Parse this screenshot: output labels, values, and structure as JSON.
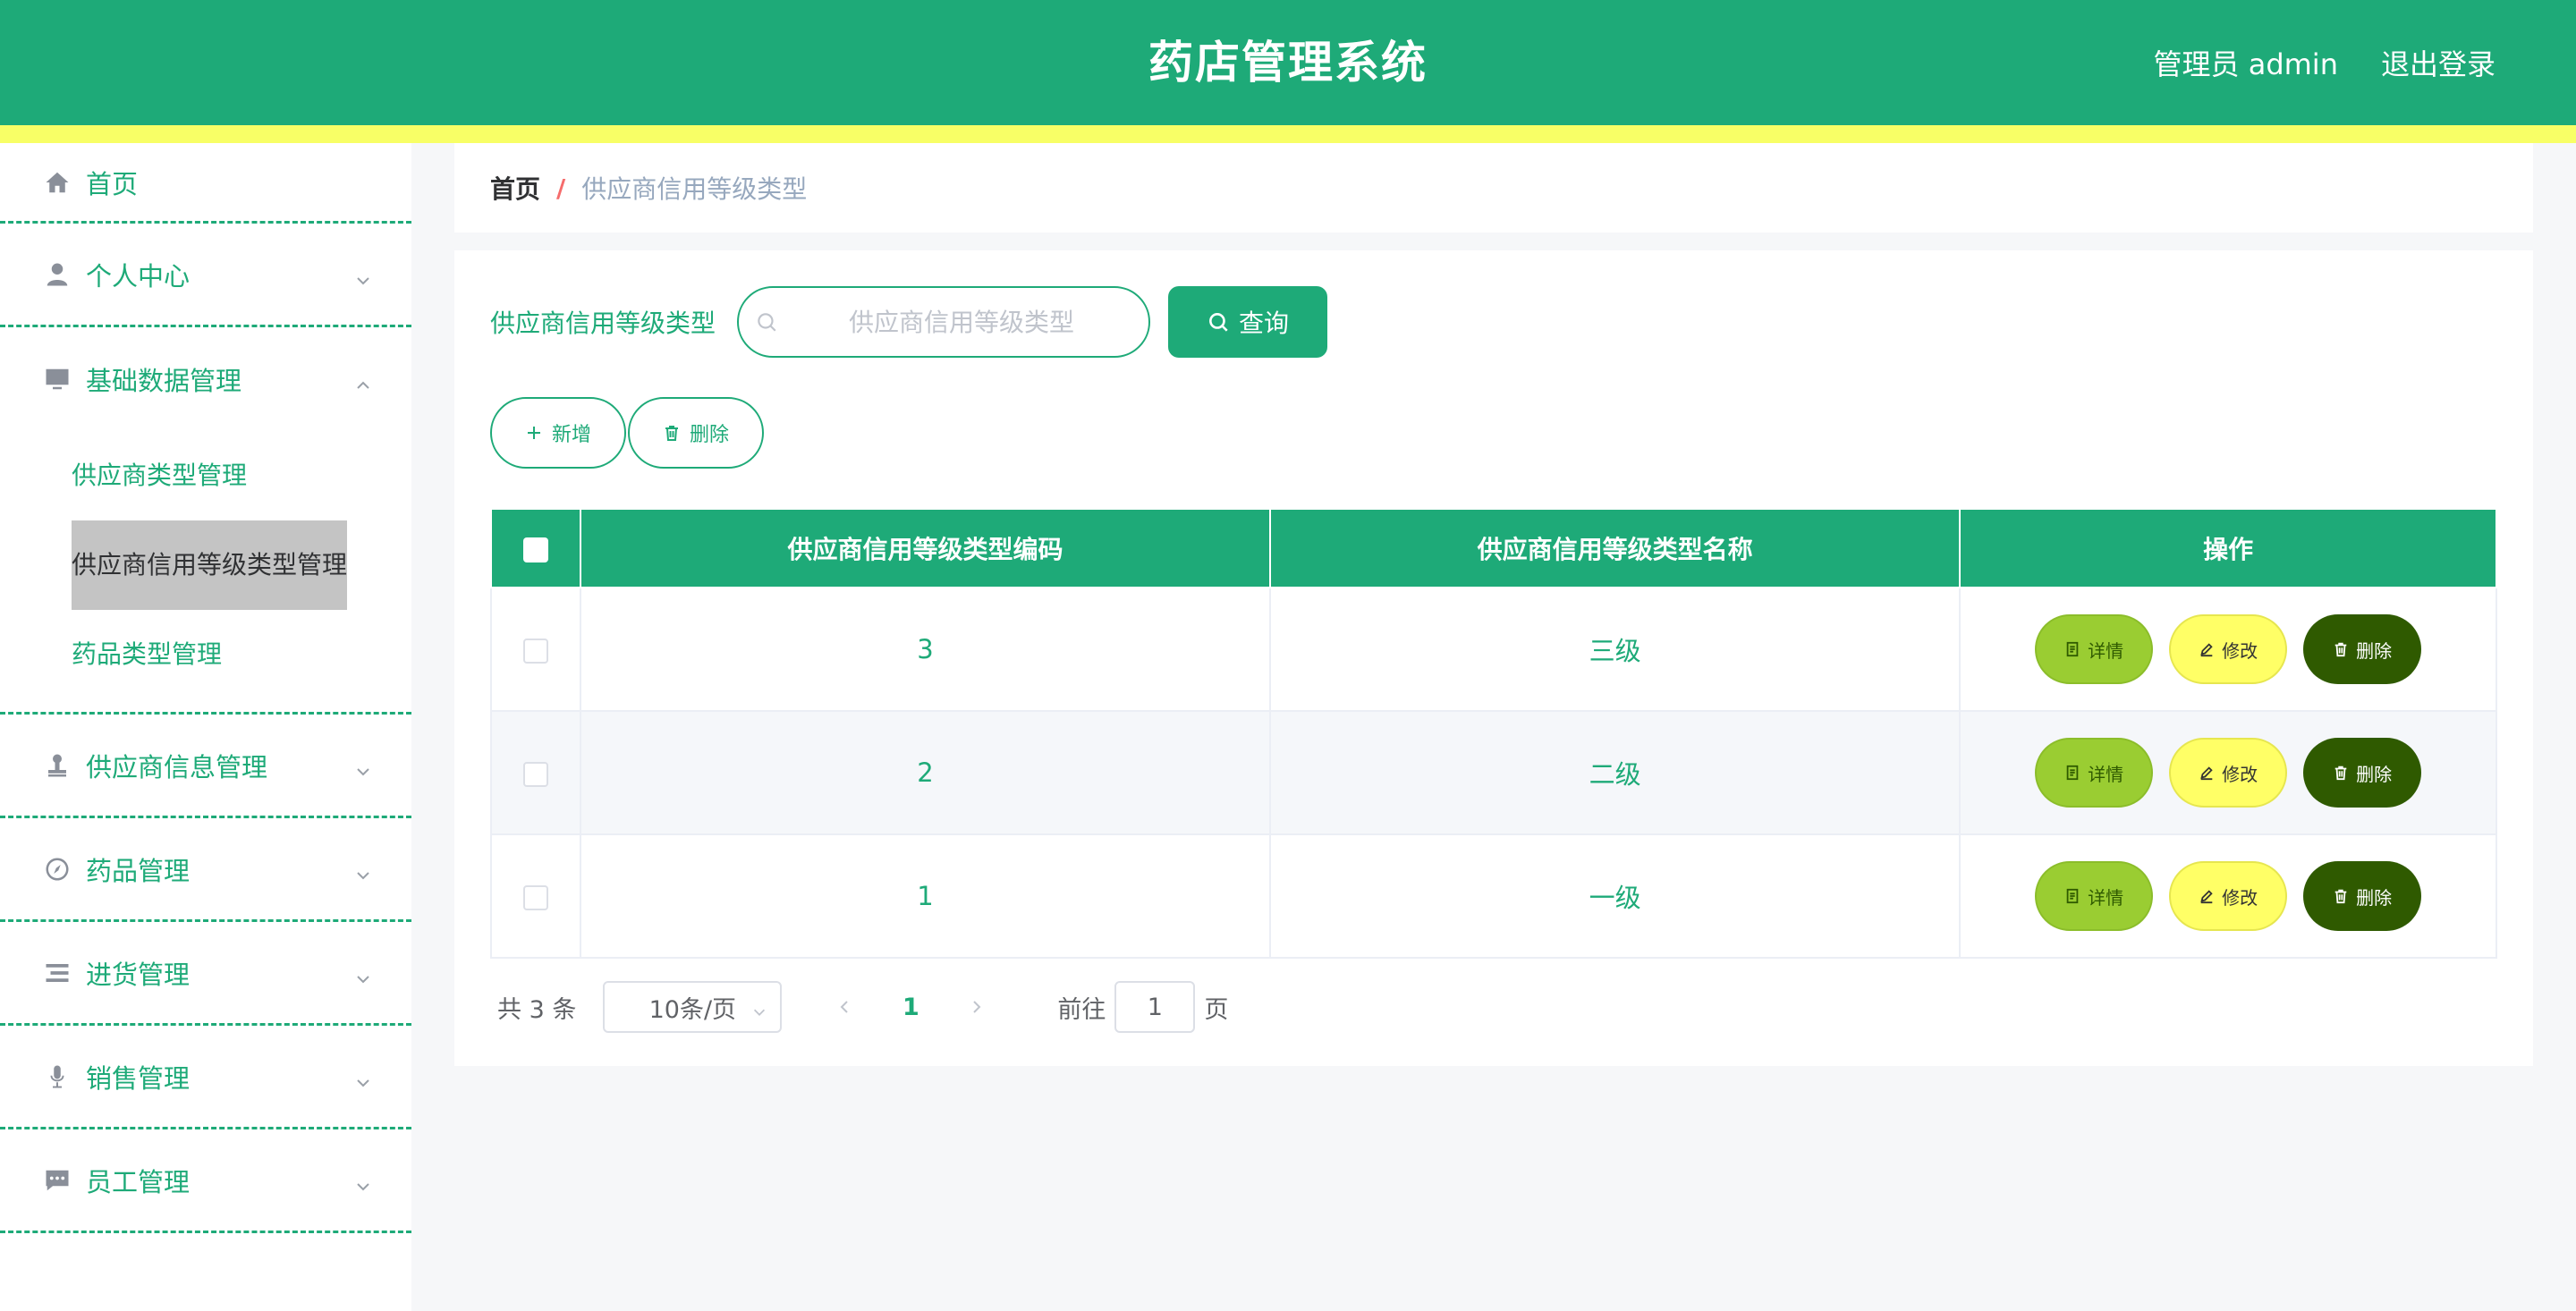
{
  "header": {
    "title": "药店管理系统",
    "user_label": "管理员 admin",
    "logout_label": "退出登录",
    "colors": {
      "primary": "#1eaa78",
      "stripe": "#f8ff66"
    }
  },
  "sidebar": {
    "items": [
      {
        "label": "首页",
        "icon": "home-icon"
      },
      {
        "label": "个人中心",
        "icon": "user-icon"
      },
      {
        "label": "基础数据管理",
        "icon": "monitor-icon",
        "expanded": true,
        "children": [
          {
            "label": "供应商类型管理"
          },
          {
            "label": "供应商信用等级类型管理",
            "active": true
          },
          {
            "label": "药品类型管理"
          }
        ]
      },
      {
        "label": "供应商信息管理",
        "icon": "stamp-icon"
      },
      {
        "label": "药品管理",
        "icon": "compass-icon"
      },
      {
        "label": "进货管理",
        "icon": "list-icon"
      },
      {
        "label": "销售管理",
        "icon": "microphone-icon"
      },
      {
        "label": "员工管理",
        "icon": "chat-icon"
      }
    ]
  },
  "breadcrumb": {
    "home": "首页",
    "separator": "/",
    "current": "供应商信用等级类型"
  },
  "search": {
    "label": "供应商信用等级类型",
    "placeholder": "供应商信用等级类型",
    "value": "",
    "button_label": "查询"
  },
  "actions": {
    "add_label": "新增",
    "delete_label": "删除"
  },
  "table": {
    "columns": [
      "供应商信用等级类型编码",
      "供应商信用等级类型名称",
      "操作"
    ],
    "rows": [
      {
        "code": "3",
        "name": "三级"
      },
      {
        "code": "2",
        "name": "二级"
      },
      {
        "code": "1",
        "name": "一级"
      }
    ],
    "row_actions": {
      "detail": "详情",
      "edit": "修改",
      "delete": "删除"
    }
  },
  "pagination": {
    "total_text": "共 3 条",
    "page_size": "10条/页",
    "current_page": "1",
    "goto_label": "前往",
    "goto_value": "1",
    "page_suffix": "页"
  }
}
